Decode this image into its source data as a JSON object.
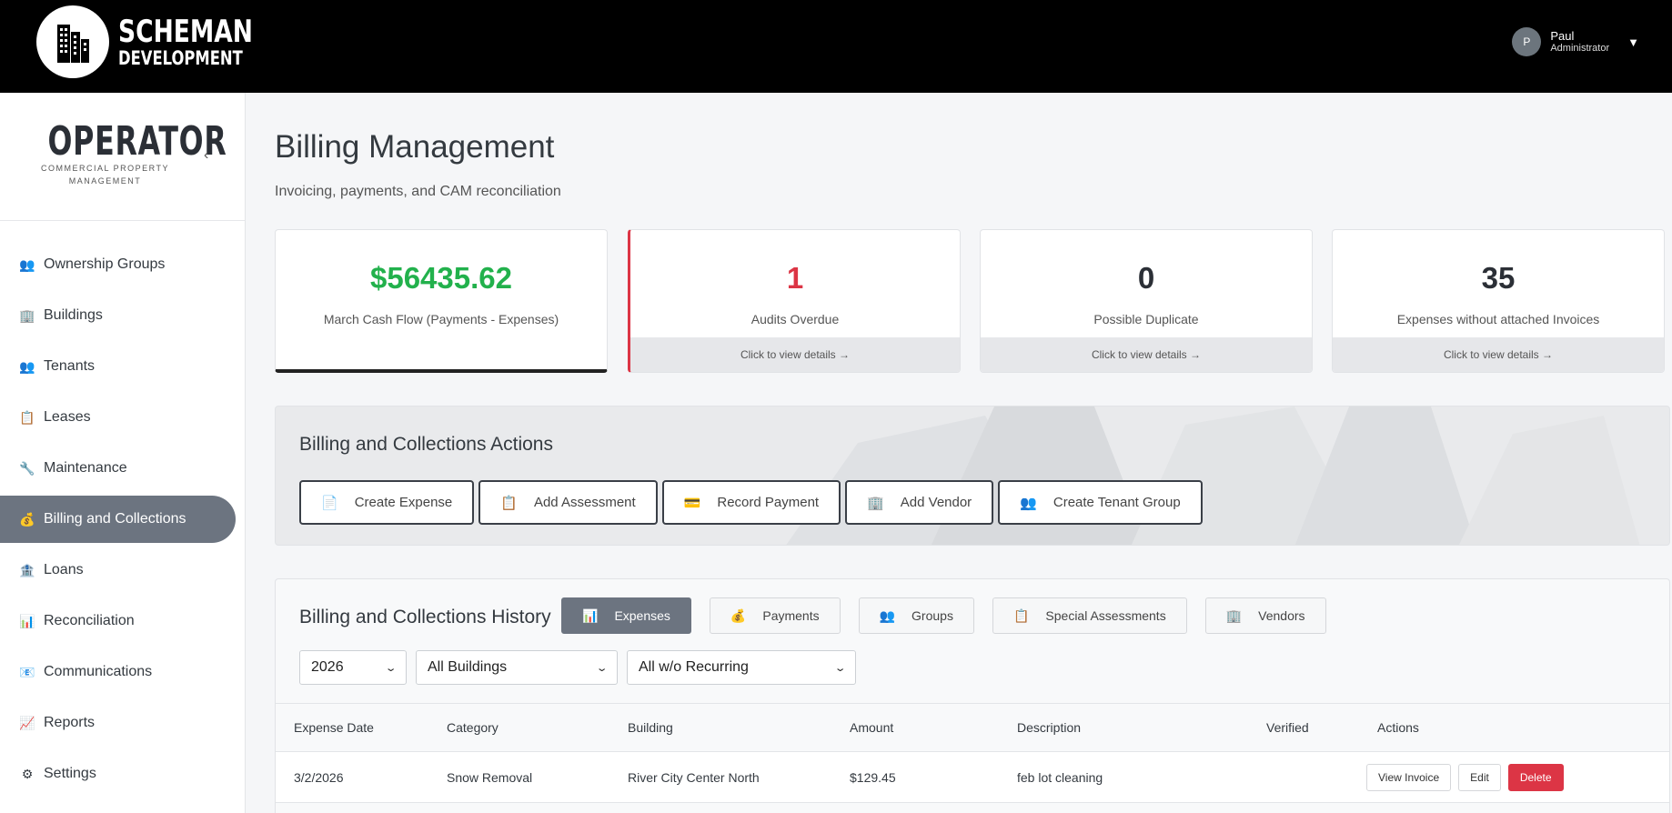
{
  "header": {
    "brand_line1": "SCHEMAN",
    "brand_line2": "DEVELOPMENT",
    "user": {
      "initial": "P",
      "name": "Paul",
      "role": "Administrator",
      "caret": "▼"
    }
  },
  "sidebar": {
    "logo_title": "OPERATOR",
    "logo_line1": "COMMERCIAL PROPERTY",
    "logo_line2": "MANAGEMENT",
    "collapse_glyph": "‹",
    "items": [
      {
        "label": "Ownership Groups",
        "icon": "👥",
        "icon_name": "people-icon"
      },
      {
        "label": "Buildings",
        "icon": "🏢",
        "icon_name": "building-icon"
      },
      {
        "label": "Tenants",
        "icon": "👥",
        "icon_name": "people-icon"
      },
      {
        "label": "Leases",
        "icon": "📋",
        "icon_name": "clipboard-icon"
      },
      {
        "label": "Maintenance",
        "icon": "🔧",
        "icon_name": "wrench-icon"
      },
      {
        "label": "Billing and Collections",
        "icon": "💰",
        "icon_name": "money-bag-icon",
        "active": true
      },
      {
        "label": "Loans",
        "icon": "🏦",
        "icon_name": "bank-icon"
      },
      {
        "label": "Reconciliation",
        "icon": "📊",
        "icon_name": "bar-chart-icon"
      },
      {
        "label": "Communications",
        "icon": "📧",
        "icon_name": "email-icon"
      },
      {
        "label": "Reports",
        "icon": "📈",
        "icon_name": "line-chart-icon"
      },
      {
        "label": "Settings",
        "icon": "⚙",
        "icon_name": "gear-icon"
      }
    ]
  },
  "page": {
    "title": "Billing Management",
    "subtitle": "Invoicing, payments, and CAM reconciliation"
  },
  "stats": [
    {
      "value": "$56435.62",
      "label": "March Cash Flow (Payments - Expenses)"
    },
    {
      "value": "1",
      "label": "Audits Overdue",
      "footer": "Click to view details →"
    },
    {
      "value": "0",
      "label": "Possible Duplicate",
      "footer": "Click to view details →"
    },
    {
      "value": "35",
      "label": "Expenses without attached Invoices",
      "footer": "Click to view details →"
    }
  ],
  "actions": {
    "title": "Billing and Collections Actions",
    "buttons": [
      {
        "label": "Create Expense",
        "icon": "📄"
      },
      {
        "label": "Add Assessment",
        "icon": "📋"
      },
      {
        "label": "Record Payment",
        "icon": "💳"
      },
      {
        "label": "Add Vendor",
        "icon": "🏢"
      },
      {
        "label": "Create Tenant Group",
        "icon": "👥"
      }
    ]
  },
  "history": {
    "title": "Billing and Collections History",
    "tabs": [
      {
        "label": "Expenses",
        "icon": "📊",
        "active": true
      },
      {
        "label": "Payments",
        "icon": "💰"
      },
      {
        "label": "Groups",
        "icon": "👥"
      },
      {
        "label": "Special Assessments",
        "icon": "📋"
      },
      {
        "label": "Vendors",
        "icon": "🏢"
      }
    ],
    "filters": {
      "year": "2026",
      "building": "All Buildings",
      "recurring": "All w/o Recurring"
    },
    "columns": [
      "Expense Date",
      "Category",
      "Building",
      "Amount",
      "Description",
      "Verified",
      "Actions"
    ],
    "rows": [
      {
        "date": "3/2/2026",
        "category": "Snow Removal",
        "building": "River City Center North",
        "amount": "$129.45",
        "description": "feb lot cleaning",
        "verified": "",
        "view_label": "View Invoice",
        "edit_label": "Edit",
        "delete_label": "Delete"
      }
    ]
  },
  "colors": {
    "accent_green": "#22b14c",
    "danger": "#dc3545",
    "active_nav": "#6c7480"
  }
}
